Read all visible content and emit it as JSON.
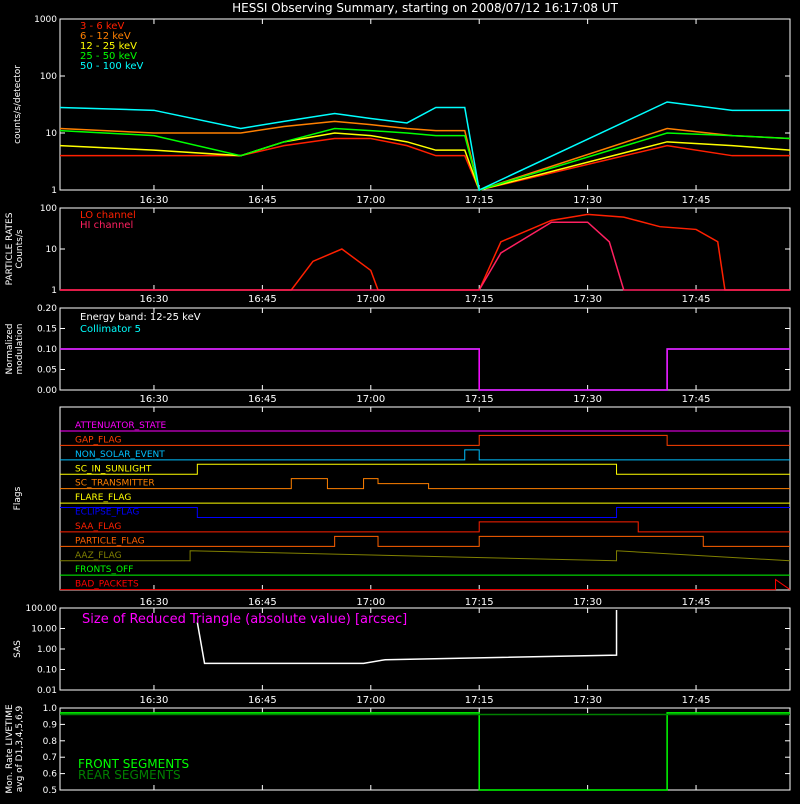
{
  "title": "HESSI Observing Summary, starting on 2008/07/12 16:17:08 UT",
  "time_axis": {
    "start": "16:17",
    "end": "17:58",
    "ticks": [
      "16:30",
      "16:45",
      "17:00",
      "17:15",
      "17:30",
      "17:45"
    ]
  },
  "colors": {
    "background": "#000000",
    "axis": "#ffffff"
  },
  "chart_data": [
    {
      "id": "counts",
      "type": "line",
      "ylabel": "counts/s/detector",
      "yscale": "log",
      "ylim": [
        1,
        1000
      ],
      "yticks": [
        "1",
        "10",
        "100",
        "1000"
      ],
      "series": [
        {
          "name": "3 - 6 keV",
          "color": "#ff2000",
          "x": [
            "16:17",
            "16:30",
            "16:42",
            "16:48",
            "16:55",
            "17:00",
            "17:05",
            "17:09",
            "17:13",
            "17:15",
            "17:41",
            "17:50",
            "17:58"
          ],
          "y": [
            4,
            4,
            4,
            6,
            8,
            8,
            6,
            4,
            4,
            1,
            6,
            4,
            4
          ]
        },
        {
          "name": "6 - 12 keV",
          "color": "#ff8000",
          "x": [
            "16:17",
            "16:30",
            "16:42",
            "16:48",
            "16:55",
            "17:00",
            "17:05",
            "17:09",
            "17:13",
            "17:15",
            "17:41",
            "17:50",
            "17:58"
          ],
          "y": [
            12,
            10,
            10,
            13,
            16,
            14,
            12,
            11,
            11,
            1,
            12,
            9,
            8
          ]
        },
        {
          "name": "12 - 25 keV",
          "color": "#ffff00",
          "x": [
            "16:17",
            "16:30",
            "16:42",
            "16:48",
            "16:55",
            "17:00",
            "17:05",
            "17:09",
            "17:13",
            "17:15",
            "17:41",
            "17:50",
            "17:58"
          ],
          "y": [
            6,
            5,
            4,
            7,
            10,
            9,
            7,
            5,
            5,
            1,
            7,
            6,
            5
          ]
        },
        {
          "name": "25 - 50 keV",
          "color": "#00ff00",
          "x": [
            "16:17",
            "16:30",
            "16:42",
            "16:48",
            "16:55",
            "17:00",
            "17:05",
            "17:09",
            "17:13",
            "17:15",
            "17:41",
            "17:50",
            "17:58"
          ],
          "y": [
            11,
            9,
            4,
            7,
            12,
            11,
            10,
            9,
            9,
            1,
            10,
            9,
            8
          ]
        },
        {
          "name": "50 - 100 keV",
          "color": "#00ffff",
          "x": [
            "16:17",
            "16:30",
            "16:42",
            "16:48",
            "16:55",
            "17:00",
            "17:05",
            "17:09",
            "17:13",
            "17:15",
            "17:41",
            "17:50",
            "17:58"
          ],
          "y": [
            28,
            25,
            12,
            16,
            22,
            18,
            15,
            28,
            28,
            1,
            35,
            25,
            25
          ]
        }
      ]
    },
    {
      "id": "particle",
      "type": "line",
      "ylabel": "PARTICLE RATES",
      "ylabel2": "Counts/s",
      "yscale": "log",
      "ylim": [
        1,
        100
      ],
      "yticks": [
        "1",
        "10",
        "100"
      ],
      "series": [
        {
          "name": "LO channel",
          "color": "#ff2000",
          "x": [
            "16:17",
            "16:49",
            "16:52",
            "16:56",
            "17:00",
            "17:01",
            "17:15",
            "17:18",
            "17:25",
            "17:30",
            "17:35",
            "17:40",
            "17:45",
            "17:48",
            "17:49",
            "17:58"
          ],
          "y": [
            1,
            1,
            5,
            10,
            3,
            1,
            1,
            15,
            50,
            70,
            60,
            35,
            30,
            15,
            1,
            1
          ]
        },
        {
          "name": "HI channel",
          "color": "#ff2060",
          "x": [
            "16:17",
            "17:15",
            "17:18",
            "17:25",
            "17:30",
            "17:33",
            "17:35",
            "17:58"
          ],
          "y": [
            1,
            1,
            8,
            45,
            45,
            15,
            1,
            1
          ]
        }
      ]
    },
    {
      "id": "modulation",
      "type": "line",
      "ylabel": "Normalized",
      "ylabel2": "modulation",
      "ylim": [
        0,
        0.2
      ],
      "yticks": [
        "0.00",
        "0.05",
        "0.10",
        "0.15",
        "0.20"
      ],
      "annotation": "Energy band: 12-25 keV",
      "series": [
        {
          "name": "Collimator 5",
          "color": "#00ffff",
          "x": [
            "16:17",
            "17:15",
            "17:15",
            "17:41",
            "17:41",
            "17:58"
          ],
          "y": [
            0.1,
            0.1,
            0.0,
            0.0,
            0.1,
            0.1
          ]
        },
        {
          "name": "",
          "color": "#ff00ff",
          "x": [
            "16:17",
            "17:15",
            "17:15",
            "17:41",
            "17:41",
            "17:58"
          ],
          "y": [
            0.1,
            0.1,
            0.0,
            0.0,
            0.1,
            0.1
          ]
        }
      ]
    },
    {
      "id": "flags",
      "type": "line",
      "ylabel": "Flags",
      "series": [
        {
          "name": "ATTENUATOR_STATE",
          "color": "#ff00ff",
          "x": [
            "16:17",
            "17:58"
          ],
          "y": [
            0,
            0
          ]
        },
        {
          "name": "GAP_FLAG",
          "color": "#ff4000",
          "x": [
            "16:17",
            "17:15",
            "17:15",
            "17:41",
            "17:41",
            "17:58"
          ],
          "y": [
            0,
            0,
            1,
            1,
            0,
            0
          ]
        },
        {
          "name": "NON_SOLAR_EVENT",
          "color": "#00c0ff",
          "x": [
            "16:17",
            "17:13",
            "17:13",
            "17:15",
            "17:15",
            "17:58"
          ],
          "y": [
            0,
            0,
            1,
            1,
            0,
            0
          ]
        },
        {
          "name": "SC_IN_SUNLIGHT",
          "color": "#ffff00",
          "x": [
            "16:17",
            "16:36",
            "16:36",
            "17:34",
            "17:34",
            "17:58"
          ],
          "y": [
            0,
            0,
            1,
            1,
            0,
            0
          ]
        },
        {
          "name": "SC_TRANSMITTER",
          "color": "#ff8000",
          "x": [
            "16:17",
            "16:49",
            "16:49",
            "16:54",
            "16:54",
            "16:59",
            "16:59",
            "17:01",
            "17:01",
            "17:08",
            "17:08",
            "17:58"
          ],
          "y": [
            0,
            0,
            1,
            1,
            0,
            0,
            1,
            1,
            0.5,
            0.5,
            0,
            0
          ]
        },
        {
          "name": "FLARE_FLAG",
          "color": "#ffff00",
          "x": [
            "16:17",
            "17:58"
          ],
          "y": [
            0,
            0
          ]
        },
        {
          "name": "ECLIPSE_FLAG",
          "color": "#0000ff",
          "x": [
            "16:17",
            "16:36",
            "16:36",
            "17:34",
            "17:34",
            "17:58"
          ],
          "y": [
            1,
            1,
            0,
            0,
            1,
            1
          ]
        },
        {
          "name": "SAA_FLAG",
          "color": "#ff2000",
          "x": [
            "16:17",
            "17:15",
            "17:15",
            "17:37",
            "17:37",
            "17:58"
          ],
          "y": [
            0,
            0,
            1,
            1,
            0,
            0
          ]
        },
        {
          "name": "PARTICLE_FLAG",
          "color": "#ff6000",
          "x": [
            "16:17",
            "16:55",
            "16:55",
            "17:01",
            "17:01",
            "17:15",
            "17:15",
            "17:46",
            "17:46",
            "17:58"
          ],
          "y": [
            0,
            0,
            1,
            1,
            0,
            0,
            1,
            1,
            0,
            0
          ]
        },
        {
          "name": "AAZ_FLAG",
          "color": "#808000",
          "x": [
            "16:17",
            "16:35",
            "16:35",
            "17:34",
            "17:34",
            "17:58"
          ],
          "y": [
            0,
            0,
            1,
            0,
            1,
            0
          ]
        },
        {
          "name": "FRONTS_OFF",
          "color": "#00ff00",
          "x": [
            "16:17",
            "17:58"
          ],
          "y": [
            0,
            0
          ]
        },
        {
          "name": "BAD_PACKETS",
          "color": "#ff0000",
          "x": [
            "16:17",
            "17:56",
            "17:56",
            "17:58"
          ],
          "y": [
            0,
            0,
            1,
            0
          ]
        }
      ]
    },
    {
      "id": "sas",
      "type": "line",
      "ylabel": "SAS",
      "yscale": "log",
      "ylim": [
        0.01,
        100
      ],
      "yticks": [
        "0.01",
        "0.10",
        "1.00",
        "10.00",
        "100.00"
      ],
      "annotation": "Size of Reduced Triangle (absolute value) [arcsec]",
      "series": [
        {
          "name": "",
          "color": "#ffffff",
          "x": [
            "16:36",
            "16:37",
            "16:59",
            "17:02",
            "17:34",
            "17:34"
          ],
          "y": [
            20,
            0.2,
            0.2,
            0.3,
            0.5,
            80
          ]
        }
      ]
    },
    {
      "id": "livetime",
      "type": "line",
      "ylabel": "Mon. Rate LIVETIME",
      "ylabel2": "avg of D1,3,4,5,6,9",
      "ylim": [
        0.5,
        1.0
      ],
      "yticks": [
        "0.5",
        "0.6",
        "0.7",
        "0.8",
        "0.9",
        "1.0"
      ],
      "series": [
        {
          "name": "FRONT SEGMENTS",
          "color": "#00ff00",
          "x": [
            "16:17",
            "17:15",
            "17:15",
            "17:41",
            "17:41",
            "17:58"
          ],
          "y": [
            0.97,
            0.97,
            0.5,
            0.5,
            0.97,
            0.97
          ]
        },
        {
          "name": "REAR SEGMENTS",
          "color": "#008000",
          "x": [
            "16:17",
            "17:15",
            "17:41",
            "17:58"
          ],
          "y": [
            0.96,
            0.96,
            0.96,
            0.96
          ]
        }
      ]
    }
  ]
}
